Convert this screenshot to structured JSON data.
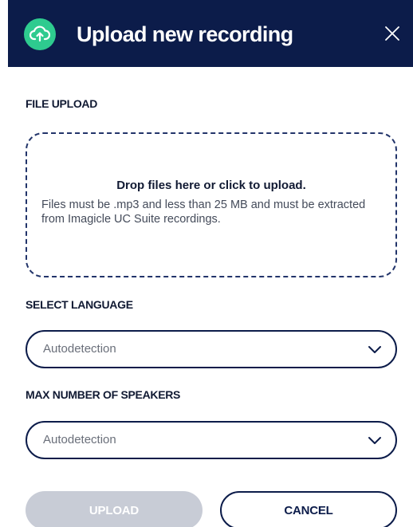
{
  "dialog": {
    "title": "Upload new recording",
    "header_icon": "cloud-upload-icon",
    "close_icon": "close-icon"
  },
  "file_upload": {
    "label": "FILE UPLOAD",
    "drop_title": "Drop files here or click to upload.",
    "drop_description": "Files must be .mp3 and less than 25 MB and must be extracted from Imagicle UC Suite recordings."
  },
  "language": {
    "label": "SELECT LANGUAGE",
    "selected": "Autodetection",
    "icon": "chevron-down-icon"
  },
  "speakers": {
    "label": "MAX NUMBER OF SPEAKERS",
    "selected": "Autodetection",
    "icon": "chevron-down-icon"
  },
  "actions": {
    "upload_label": "UPLOAD",
    "cancel_label": "CANCEL"
  },
  "colors": {
    "header_bg": "#0c1c4a",
    "accent_green": "#2ecb8f",
    "disabled_button": "#c8ccd6"
  }
}
